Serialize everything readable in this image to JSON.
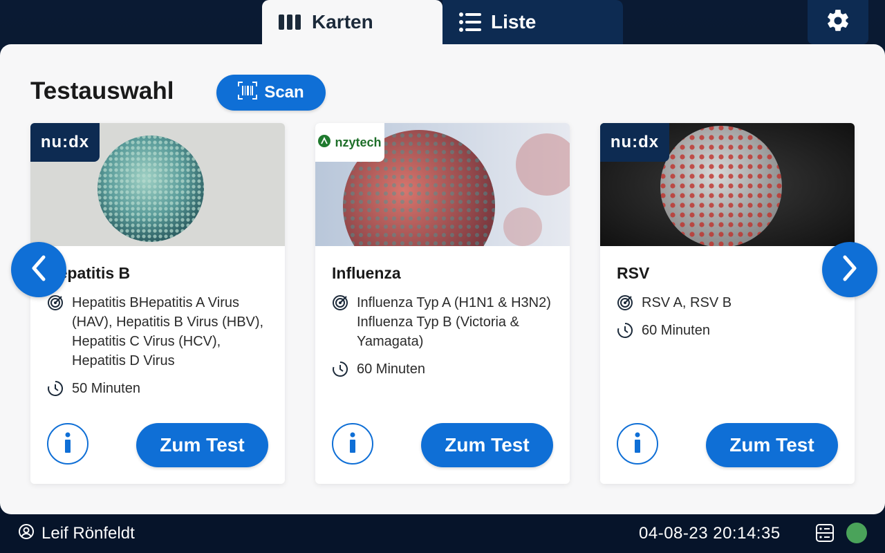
{
  "tabs": [
    {
      "label": "Karten",
      "icon": "columns-icon",
      "active": true
    },
    {
      "label": "Liste",
      "icon": "list-icon",
      "active": false
    }
  ],
  "header": {
    "settings_icon": "gear-icon"
  },
  "main": {
    "title": "Testauswahl",
    "scan_label": "Scan",
    "cards": [
      {
        "brand": "nu:dx",
        "title": "Hepatitis B",
        "targets": "Hepatitis BHepatitis A Virus (HAV), Hepatitis B Virus (HBV), Hepatitis C Virus (HCV), Hepatitis D Virus",
        "duration": "50 Minuten",
        "button": "Zum Test"
      },
      {
        "brand": "nzytech",
        "title": "Influenza",
        "targets": "Influenza Typ A (H1N1 & H3N2) Influenza Typ B (Victoria & Yamagata)",
        "duration": "60 Minuten",
        "button": "Zum Test"
      },
      {
        "brand": "nu:dx",
        "title": "RSV",
        "targets": "RSV A, RSV B",
        "duration": "60 Minuten",
        "button": "Zum Test"
      }
    ]
  },
  "footer": {
    "user": "Leif Rönfeldt",
    "datetime": "04-08-23 20:14:35",
    "status_color": "#4aa35a"
  },
  "colors": {
    "accent": "#0f6fd6",
    "navy": "#0d2b52"
  }
}
